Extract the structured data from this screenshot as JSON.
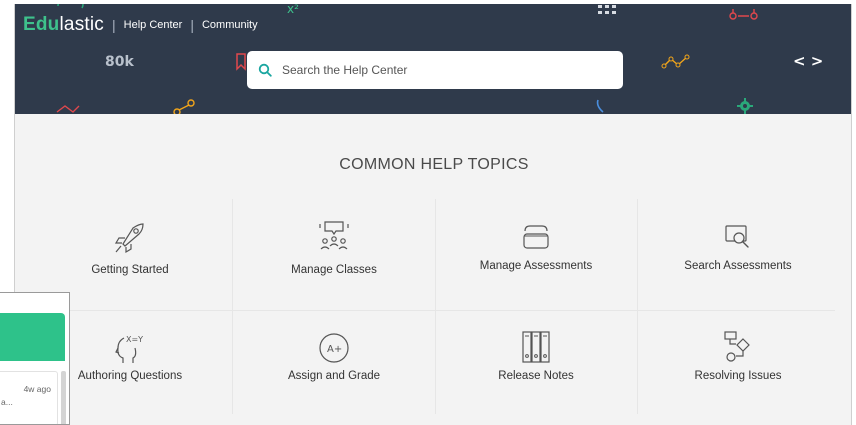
{
  "header": {
    "logo_primary": "Edu",
    "logo_secondary": "lastic",
    "separator": "|",
    "nav_links": [
      "Help Center",
      "Community"
    ],
    "background_color": "#2f3a4b",
    "accent_color": "#3ec18c",
    "decorations": {
      "counter": "80k",
      "formula": "x²",
      "code_brackets": "< >"
    }
  },
  "search": {
    "placeholder": "Search the Help Center"
  },
  "main": {
    "section_title": "COMMON HELP TOPICS",
    "topics": [
      {
        "label": "Getting Started",
        "icon": "rocket-icon"
      },
      {
        "label": "Manage Classes",
        "icon": "classroom-icon"
      },
      {
        "label": "Manage Assessments",
        "icon": "folder-icon"
      },
      {
        "label": "Search Assessments",
        "icon": "search-document-icon"
      },
      {
        "label": "Authoring Questions",
        "icon": "thinking-head-icon"
      },
      {
        "label": "Assign and Grade",
        "icon": "grade-a-plus-icon"
      },
      {
        "label": "Release Notes",
        "icon": "binders-icon"
      },
      {
        "label": "Resolving Issues",
        "icon": "flowchart-icon"
      }
    ]
  },
  "chat_widget": {
    "header_color": "#2ec28a",
    "time": "4w ago",
    "snippet": "a..."
  }
}
